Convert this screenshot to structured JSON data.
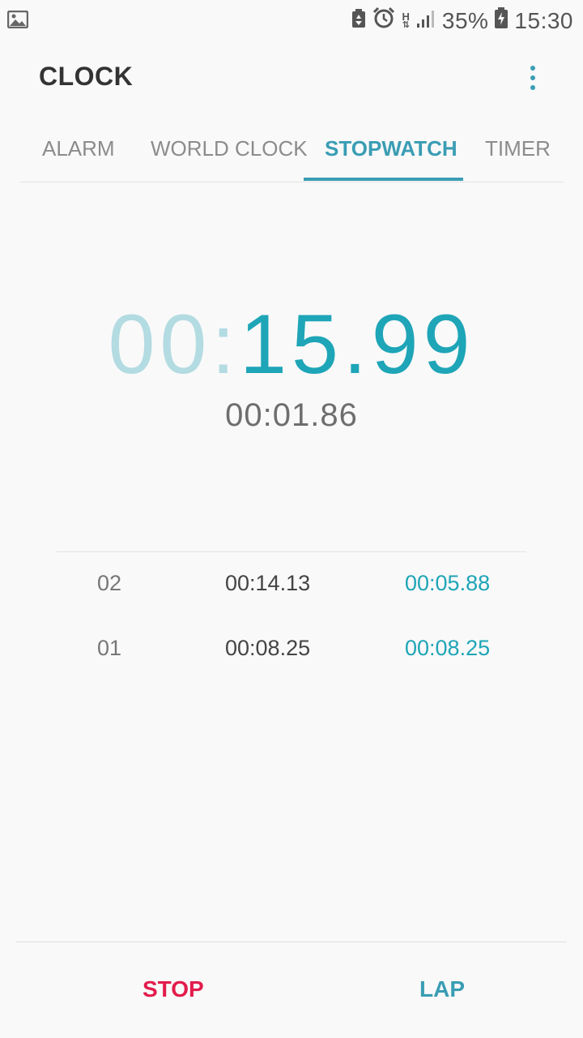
{
  "status_bar": {
    "battery_percent": "35%",
    "time": "15:30",
    "network": "H",
    "icons": [
      "image-icon",
      "battery-saver-icon",
      "alarm-icon",
      "network-h-icon",
      "signal-icon",
      "battery-charging-icon"
    ]
  },
  "app": {
    "title": "CLOCK"
  },
  "tabs": [
    {
      "label": "ALARM",
      "active": false
    },
    {
      "label": "WORLD CLOCK",
      "active": false
    },
    {
      "label": "STOPWATCH",
      "active": true
    },
    {
      "label": "TIMER",
      "active": false
    }
  ],
  "stopwatch": {
    "minutes": "00",
    "separator": ":",
    "seconds": "15.99",
    "current_lap": "00:01.86"
  },
  "laps": [
    {
      "number": "02",
      "total": "00:14.13",
      "split": "00:05.88"
    },
    {
      "number": "01",
      "total": "00:08.25",
      "split": "00:08.25"
    }
  ],
  "buttons": {
    "stop": "STOP",
    "lap": "LAP"
  },
  "colors": {
    "accent": "#3a9db4",
    "time_accent": "#1ea5b7",
    "time_faded": "#b3dbe2",
    "stop": "#e21c4c",
    "background": "#f9f9f9"
  }
}
